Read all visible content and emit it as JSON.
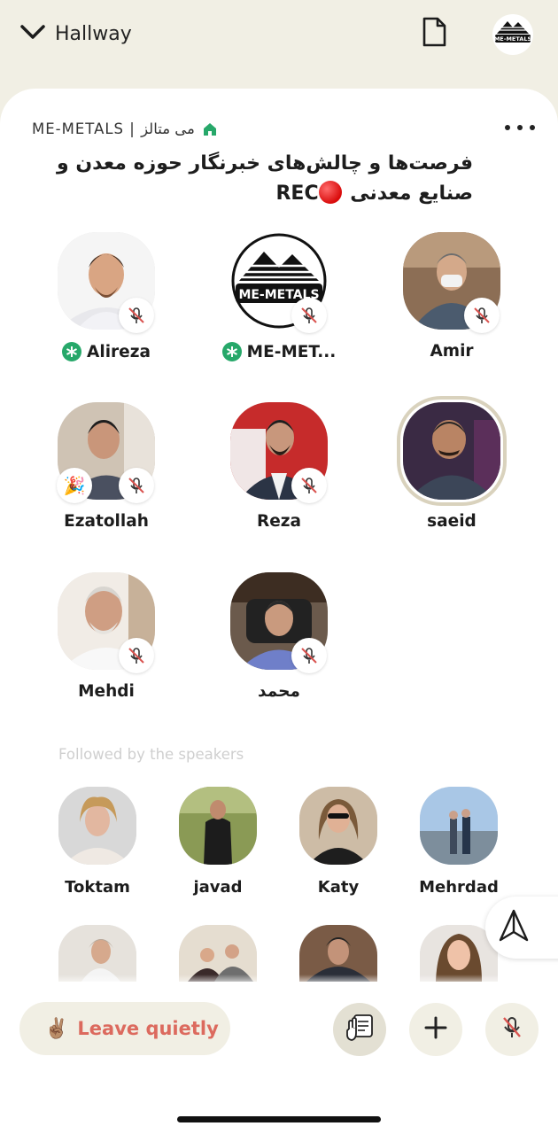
{
  "topbar": {
    "back_label": "Hallway",
    "back_icon": "chevron-down-icon",
    "document_icon": "document-icon",
    "club_avatar_text": "ME-METALS"
  },
  "room": {
    "club_name": "ME-METALS | می متالز",
    "title": "فرصت‌ها و چالش‌های خبرنگار حوزه معدن و صنایع معدنی",
    "rec_label": "REC",
    "more_icon": "more-horizontal-icon"
  },
  "speakers": [
    {
      "name": "Alireza",
      "moderator": true,
      "muted": true
    },
    {
      "name": "ME-MET...",
      "moderator": true,
      "muted": true,
      "logo_text": "ME-METALS"
    },
    {
      "name": "Amir",
      "moderator": false,
      "muted": true
    },
    {
      "name": "Ezatollah",
      "moderator": false,
      "muted": true,
      "badge": "🎉"
    },
    {
      "name": "Reza",
      "moderator": false,
      "muted": true
    },
    {
      "name": "saeid",
      "moderator": false,
      "muted": false,
      "speaking": true
    },
    {
      "name": "Mehdi",
      "moderator": false,
      "muted": true
    },
    {
      "name": "محمد",
      "moderator": false,
      "muted": true
    }
  ],
  "followed_label": "Followed by the speakers",
  "listeners": [
    {
      "name": "Toktam"
    },
    {
      "name": "javad"
    },
    {
      "name": "Katy"
    },
    {
      "name": "Mehrdad"
    },
    {
      "name": ""
    },
    {
      "name": ""
    },
    {
      "name": ""
    },
    {
      "name": ""
    }
  ],
  "bottom": {
    "leave_label": "Leave quietly",
    "leave_emoji": "✌🏽",
    "raise_hand_icon": "raise-hand-icon",
    "add_icon": "plus-icon",
    "mic_icon": "mic-off-icon",
    "share_icon": "share-icon"
  },
  "colors": {
    "background": "#f1efe4",
    "leave_text": "#dc6a5e",
    "moderator_green": "#27a86a",
    "home_green": "#27a86a",
    "rec_red": "#d90b0b",
    "mute_red": "#d9534f"
  }
}
